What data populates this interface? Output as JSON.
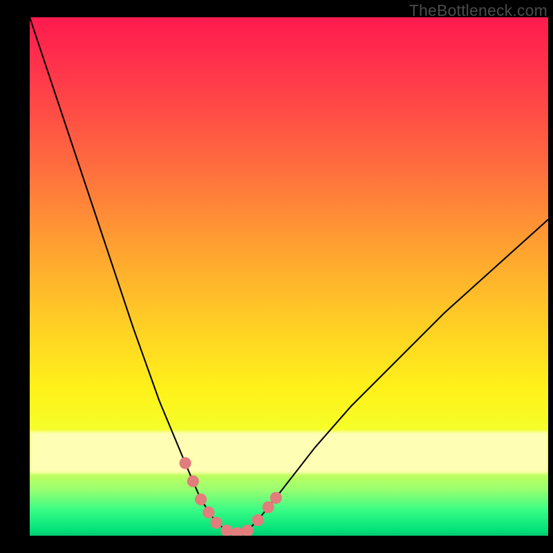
{
  "watermark": {
    "text": "TheBottleneck.com"
  },
  "chart_data": {
    "type": "line",
    "title": "",
    "xlabel": "",
    "ylabel": "",
    "xlim": [
      0,
      100
    ],
    "ylim": [
      0,
      100
    ],
    "series": [
      {
        "name": "bottleneck-curve",
        "x": [
          0,
          5,
          10,
          15,
          20,
          25,
          30,
          33,
          36,
          38,
          40,
          42,
          44,
          48,
          55,
          62,
          70,
          80,
          90,
          100
        ],
        "values": [
          100,
          85,
          70,
          55,
          40,
          26,
          14,
          7,
          2.5,
          1,
          0.5,
          1,
          3,
          8,
          17,
          25,
          33,
          43,
          52,
          61
        ]
      }
    ],
    "markers": {
      "name": "highlight-dots",
      "x": [
        30,
        31.5,
        33,
        34.5,
        36,
        38,
        40,
        42,
        44,
        46,
        47.5
      ],
      "values": [
        14,
        10.5,
        7,
        4.5,
        2.5,
        1,
        0.5,
        1,
        3,
        5.5,
        7.3
      ]
    },
    "gradient_stops": [
      {
        "pos": 0,
        "color": "#ff1a4e"
      },
      {
        "pos": 28,
        "color": "#ff6a3f"
      },
      {
        "pos": 60,
        "color": "#ffd124"
      },
      {
        "pos": 82,
        "color": "#f8ff88"
      },
      {
        "pos": 95,
        "color": "#3afc85"
      },
      {
        "pos": 100,
        "color": "#00c86f"
      }
    ]
  }
}
